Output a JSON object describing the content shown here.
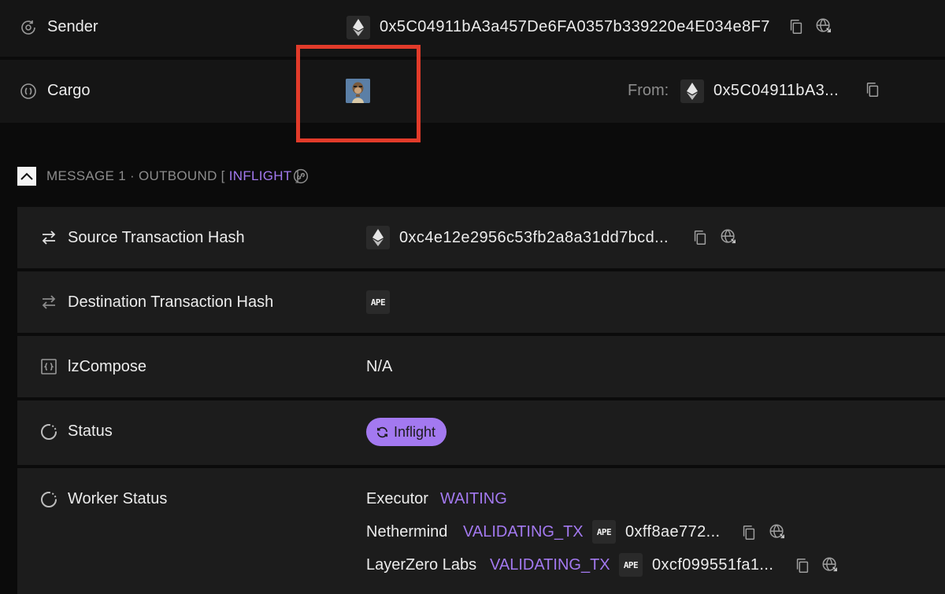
{
  "sender": {
    "label": "Sender",
    "address": "0x5C04911bA3a457De6FA0357b339220e4E034e8F7"
  },
  "cargo": {
    "label": "Cargo",
    "from_label": "From:",
    "from_address": "0x5C04911bA3..."
  },
  "message": {
    "prefix": "MESSAGE 1 · OUTBOUND [",
    "status": "INFLIGHT",
    "suffix": "]"
  },
  "rows": {
    "source_tx": {
      "label": "Source Transaction Hash",
      "value": "0xc4e12e2956c53fb2a8a31dd7bcd..."
    },
    "dest_tx": {
      "label": "Destination Transaction Hash",
      "chain": "APE"
    },
    "lz_compose": {
      "label": "lzCompose",
      "value": "N/A"
    },
    "status": {
      "label": "Status",
      "badge": "Inflight"
    },
    "worker_status": {
      "label": "Worker Status",
      "executor": {
        "name": "Executor",
        "state": "WAITING"
      },
      "nethermind": {
        "name": "Nethermind",
        "state": "VALIDATING_TX",
        "chain": "APE",
        "hash": "0xff8ae772..."
      },
      "layerzero": {
        "name": "LayerZero Labs",
        "state": "VALIDATING_TX",
        "chain": "APE",
        "hash": "0xcf099551fa1..."
      }
    }
  },
  "colors": {
    "accent": "#a379f0",
    "highlight_box": "#e23b2a",
    "background": "#0b0b0b",
    "panel": "#1c1c1c"
  }
}
